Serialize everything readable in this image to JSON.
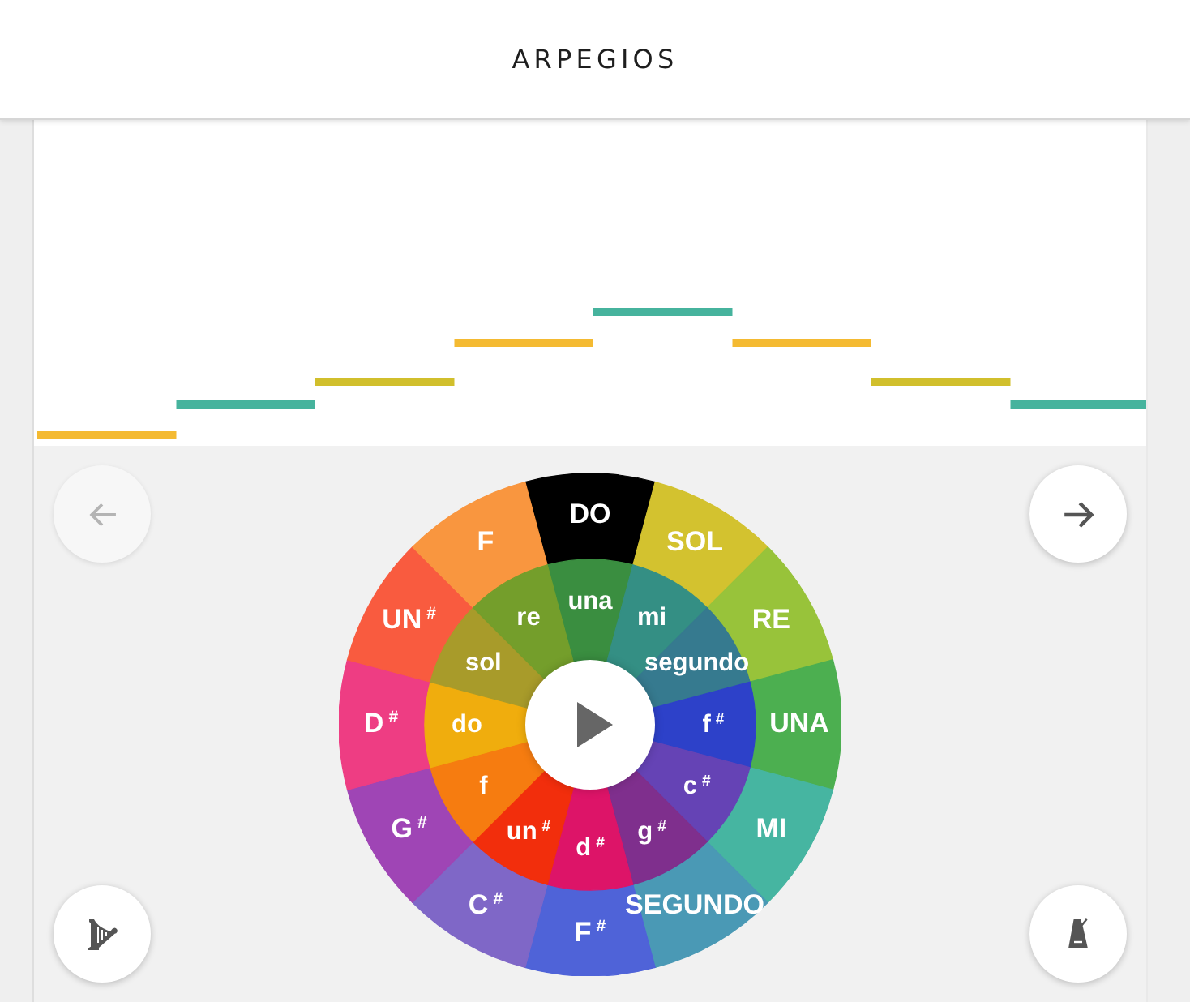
{
  "header": {
    "title": "ARPEGIOS"
  },
  "roll": {
    "notes": [
      {
        "color": "#f4ba32"
      },
      {
        "color": "#46b39d"
      },
      {
        "color": "#d1bf2c"
      },
      {
        "color": "#f4ba32"
      },
      {
        "color": "#46b39d"
      },
      {
        "color": "#f4ba32"
      },
      {
        "color": "#d1bf2c"
      },
      {
        "color": "#46b39d"
      }
    ]
  },
  "left_column": [
    {
      "kind": "back",
      "disabled": true
    },
    {
      "kind": "harp",
      "disabled": false
    }
  ],
  "right_column": [
    {
      "kind": "forward",
      "disabled": false
    },
    {
      "kind": "metronome",
      "disabled": false
    }
  ],
  "wheel": {
    "outer_keys": [
      {
        "label": "DO",
        "selected": true
      },
      {
        "label": "SOL",
        "color": "#d3c22f",
        "selected": false
      },
      {
        "label": "RE",
        "color": "#98c33a",
        "selected": false
      },
      {
        "label": "UNA",
        "color": "#4caf50",
        "selected": false
      },
      {
        "label": "MI",
        "color": "#46b5a1",
        "selected": false
      },
      {
        "label": "SEGUNDO",
        "color": "#4a99b5",
        "selected": false
      },
      {
        "label": "F$^{#}$",
        "color": "#4f63d8",
        "selected": false
      },
      {
        "label": "C$^{#}$",
        "color": "#7f67c7",
        "selected": false
      },
      {
        "label": "G$^{#}$",
        "color": "#9f45b5",
        "selected": false
      },
      {
        "label": "D$^{#}$",
        "color": "#ee3d83",
        "selected": false
      },
      {
        "label": "UN$^{#}$",
        "color": "#f95b3f",
        "selected": false
      },
      {
        "label": "F",
        "color": "#f9963f",
        "selected": false
      }
    ],
    "inner_keys": [
      {
        "label": "una",
        "color": "#3a8e40",
        "selected": false
      },
      {
        "label": "mi",
        "color": "#348f84",
        "selected": false
      },
      {
        "label": "segundo",
        "color": "#367a8f",
        "selected": false
      },
      {
        "label": "f$^{#}$",
        "color": "#2d41c9",
        "selected": false
      },
      {
        "label": "c$^{#}$",
        "color": "#6543b5",
        "selected": false
      },
      {
        "label": "g$^{#}$",
        "color": "#7f2f8d",
        "selected": false
      },
      {
        "label": "d$^{#}$",
        "color": "#dd1468",
        "selected": false
      },
      {
        "label": "un$^{#}$",
        "color": "#f22e0c",
        "selected": false
      },
      {
        "label": "f",
        "color": "#f67c10",
        "selected": false
      },
      {
        "label": "do",
        "color": "#f0ad0d",
        "selected": false
      },
      {
        "label": "sol",
        "color": "#a89b2a",
        "selected": false
      },
      {
        "label": "re",
        "color": "#749e2b",
        "selected": false
      }
    ],
    "play_button": {
      "playing": false
    }
  }
}
